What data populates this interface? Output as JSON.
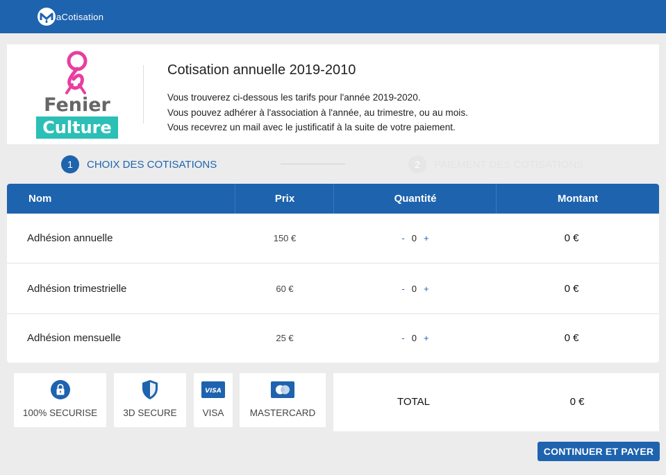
{
  "app": {
    "brand_name": "aCotisation"
  },
  "intro": {
    "logo_line1": "Fenier",
    "logo_line2": "Culture",
    "title": "Cotisation annuelle 2019-2010",
    "lines": [
      "Vous trouverez ci-dessous les tarifs pour l'année 2019-2020.",
      "Vous pouvez adhérer à l'association à l'année, au trimestre, ou au mois.",
      "Vous recevrez un mail avec le justificatif à la suite de votre paiement."
    ]
  },
  "steps": [
    {
      "number": "1",
      "label": "CHOIX DES COTISATIONS",
      "active": true
    },
    {
      "number": "2",
      "label": "PAIEMENT DES COTISATIONS",
      "active": false
    }
  ],
  "table": {
    "headers": {
      "name": "Nom",
      "price": "Prix",
      "quantity": "Quantité",
      "amount": "Montant"
    },
    "rows": [
      {
        "name": "Adhésion annuelle",
        "price": "150 €",
        "minus": "-",
        "quantity": "0",
        "plus": "+",
        "amount": "0 €"
      },
      {
        "name": "Adhésion trimestrielle",
        "price": "60 €",
        "minus": "-",
        "quantity": "0",
        "plus": "+",
        "amount": "0 €"
      },
      {
        "name": "Adhésion mensuelle",
        "price": "25 €",
        "minus": "-",
        "quantity": "0",
        "plus": "+",
        "amount": "0 €"
      }
    ]
  },
  "badges": [
    {
      "label": "100% SECURISE",
      "icon": "lock-icon"
    },
    {
      "label": "3D SECURE",
      "icon": "shield-icon"
    },
    {
      "label": "VISA",
      "icon": "visa-card-icon",
      "icon_text": "VISA"
    },
    {
      "label": "MASTERCARD",
      "icon": "mastercard-icon"
    }
  ],
  "total": {
    "label": "TOTAL",
    "value": "0 €"
  },
  "actions": {
    "pay_label": "CONTINUER ET PAYER"
  },
  "colors": {
    "primary": "#1e63ae",
    "background": "#ececec",
    "logo_pink": "#e83e9f",
    "logo_teal": "#2bbfb6",
    "logo_gray": "#666666"
  }
}
